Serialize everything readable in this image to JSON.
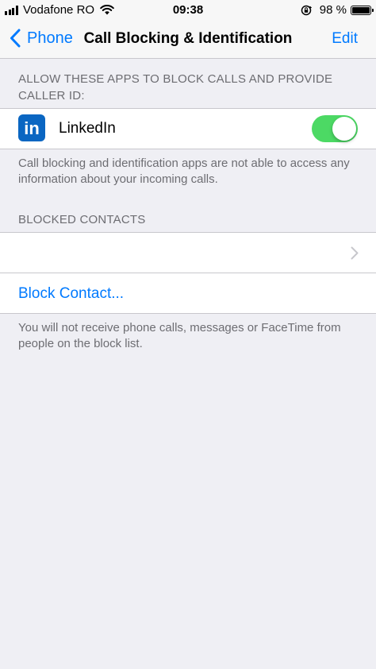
{
  "status_bar": {
    "carrier": "Vodafone RO",
    "time": "09:38",
    "battery_percent": "98 %",
    "battery_level": 0.98
  },
  "nav": {
    "back_label": "Phone",
    "title": "Call Blocking & Identification",
    "edit_label": "Edit"
  },
  "apps_section": {
    "header": "ALLOW THESE APPS TO BLOCK CALLS AND PROVIDE CALLER ID:",
    "apps": [
      {
        "icon_text": "in",
        "icon": "linkedin-icon",
        "name": "LinkedIn",
        "enabled": true
      }
    ],
    "footer": "Call blocking and identification apps are not able to access any information about your incoming calls."
  },
  "blocked_section": {
    "header": "BLOCKED CONTACTS",
    "contacts": [
      {
        "name": ""
      }
    ],
    "block_contact_label": "Block Contact...",
    "footer": "You will not receive phone calls, messages or FaceTime from people on the block list."
  },
  "colors": {
    "accent": "#007aff",
    "toggle_on": "#4cd964",
    "linkedin": "#0a66c2",
    "background": "#efeff4"
  }
}
